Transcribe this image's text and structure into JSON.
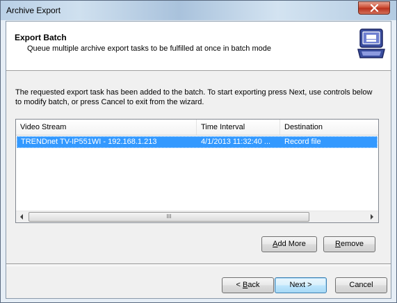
{
  "window": {
    "title": "Archive Export",
    "close_icon": "close-icon"
  },
  "header": {
    "title": "Export Batch",
    "subtitle": "Queue multiple archive export tasks to be fulfilled at once in batch mode",
    "icon": "laptop-icon"
  },
  "description": "The requested export task has been added to the batch. To start exporting press Next, use controls below to modify batch, or press Cancel to exit from the wizard.",
  "batch_list": {
    "columns": [
      "Video Stream",
      "Time Interval",
      "Destination"
    ],
    "rows": [
      {
        "video_stream": "TRENDnet TV-IP551WI - 192.168.1.213",
        "time_interval": "4/1/2013 11:32:40 ...",
        "destination": "Record file",
        "selected": true
      }
    ],
    "scrollbar_grip": "III"
  },
  "buttons": {
    "add_more": {
      "key": "A",
      "rest": "dd More"
    },
    "remove": {
      "key": "R",
      "rest": "emove"
    },
    "back": {
      "prefix": "< ",
      "key": "B",
      "rest": "ack"
    },
    "next": "Next >",
    "cancel": "Cancel"
  },
  "colors": {
    "selection": "#3399ff",
    "close_button": "#c9452b",
    "window_frame": "#b9d0e6"
  }
}
